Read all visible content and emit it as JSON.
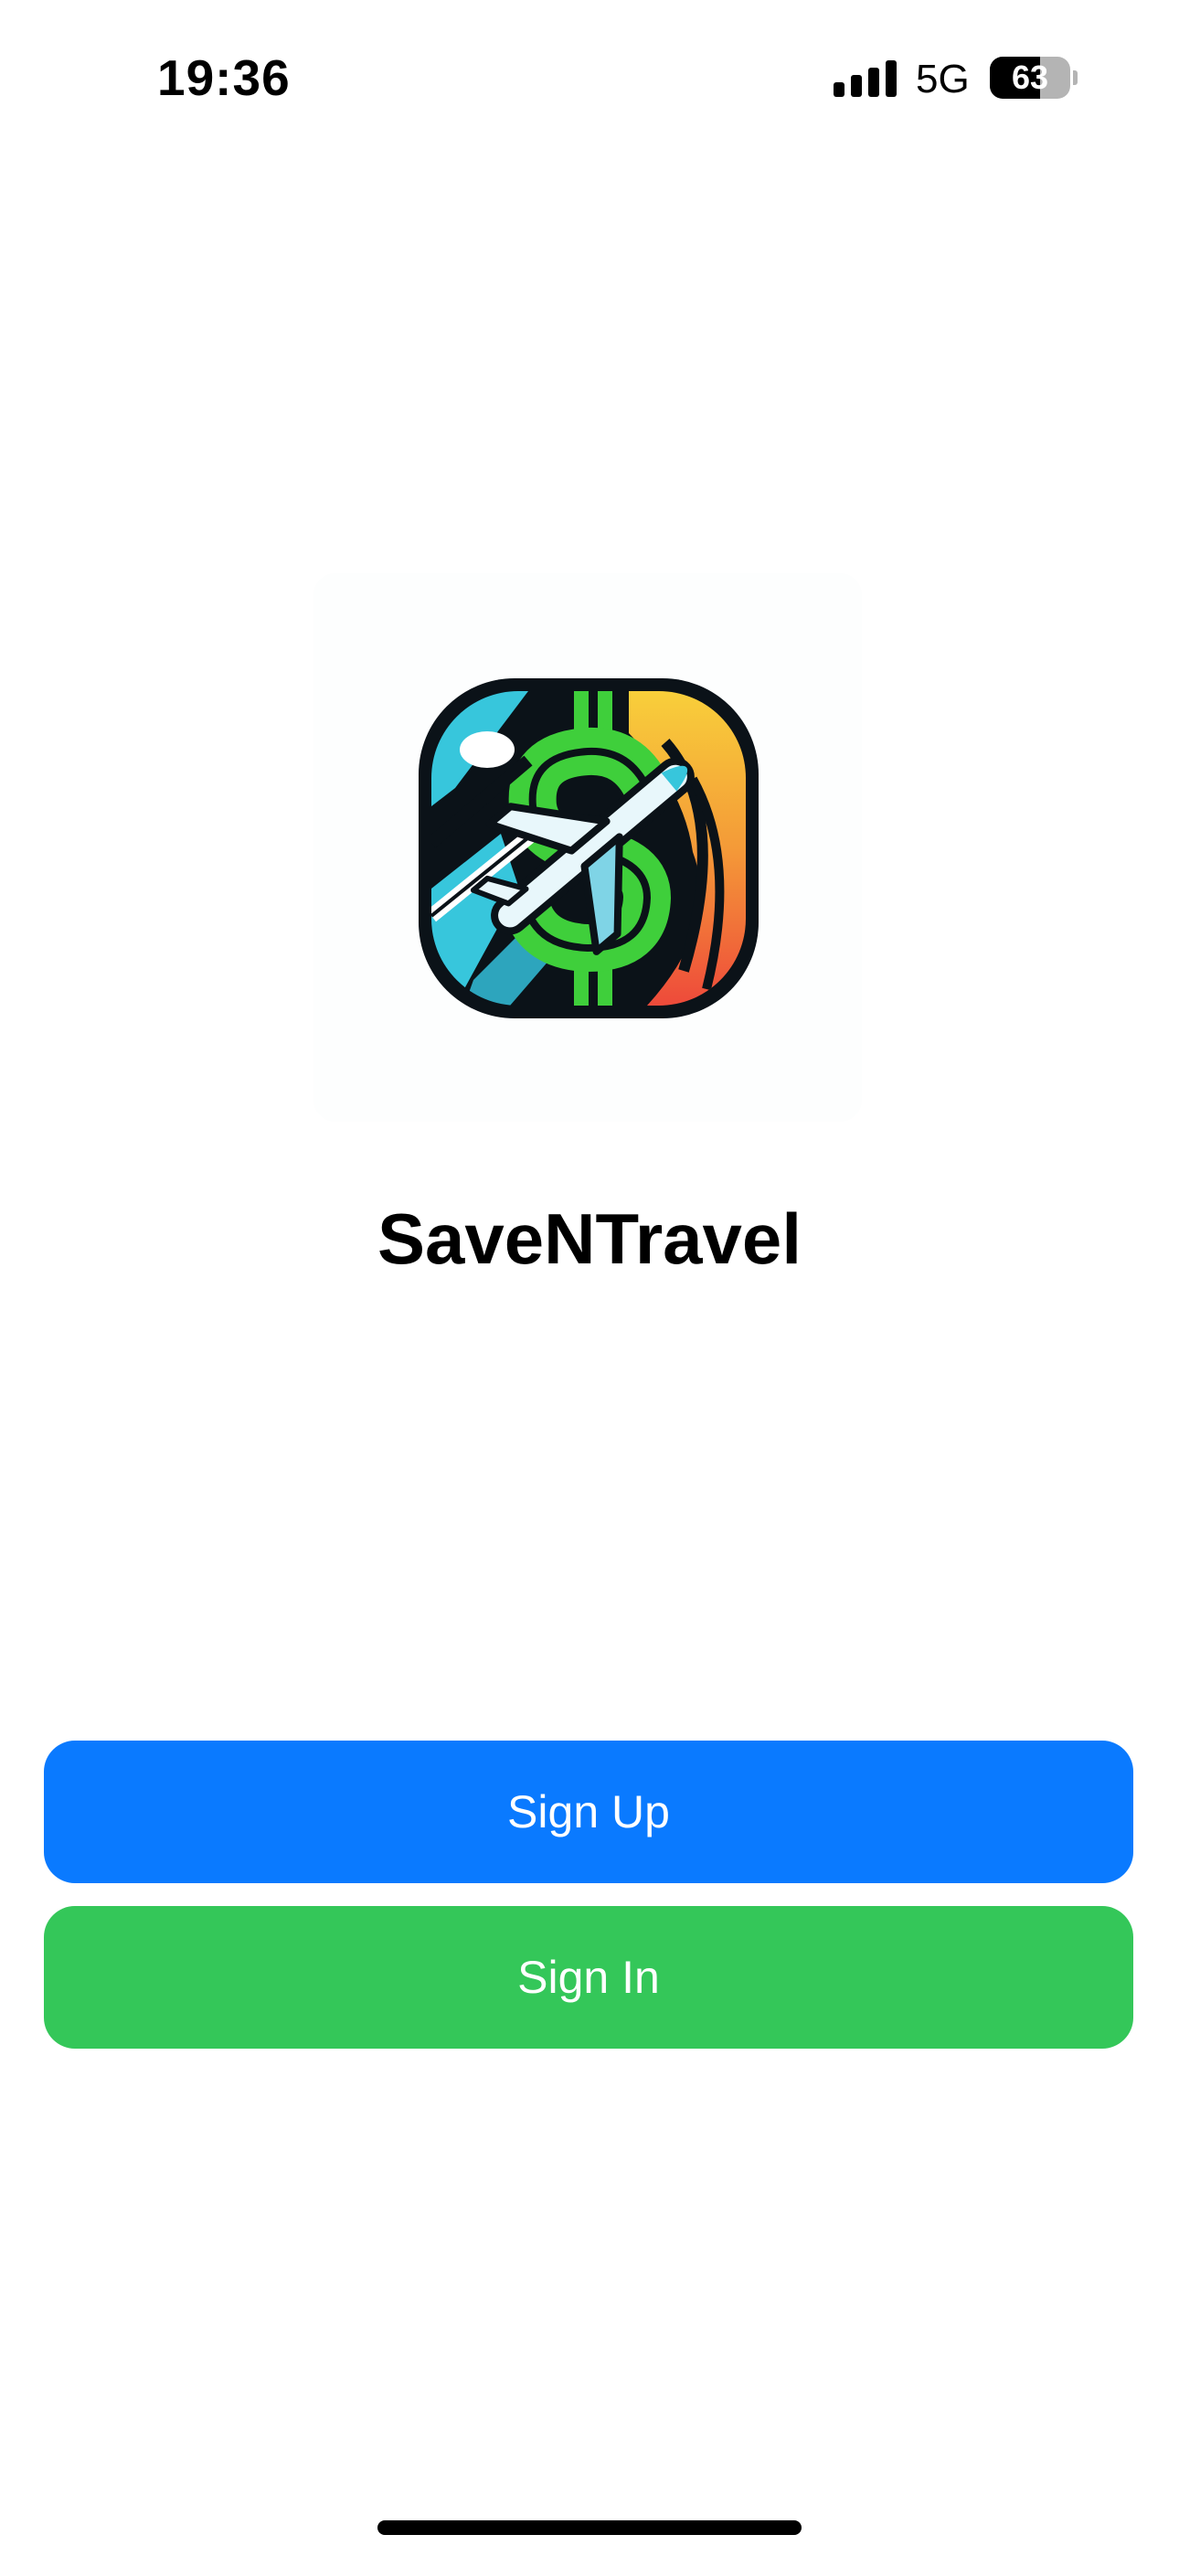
{
  "status_bar": {
    "time": "19:36",
    "network": "5G",
    "battery_level": "63",
    "battery_fraction": 0.63,
    "icons": [
      "signal-bars-icon",
      "battery-icon"
    ]
  },
  "logo": {
    "icon": "app-logo-icon",
    "description_colors": {
      "outline": "#0b1218",
      "cyan": "#37c6dc",
      "green": "#3fcf3b",
      "orange": "#f6a43a",
      "red": "#ee4a3a"
    }
  },
  "app": {
    "title": "SaveNTravel"
  },
  "buttons": {
    "sign_up": "Sign Up",
    "sign_in": "Sign In"
  },
  "colors": {
    "sign_up_bg": "#0a7aff",
    "sign_in_bg": "#34c759",
    "background": "#ffffff",
    "text": "#000000"
  }
}
